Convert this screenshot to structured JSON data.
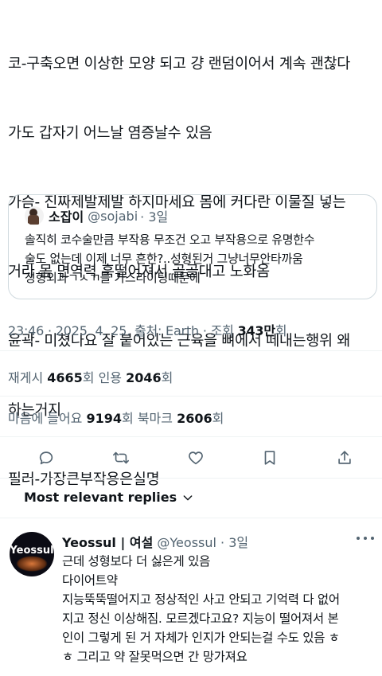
{
  "tweet": {
    "lines": [
      "코-구축오면 이상한 모양 되고 걍 랜덤이어서 계속 괜찮다",
      "가도 갑자기 어느날 염증날수 있음",
      "가슴- 진짜제발제발 하지마세요 몸에 커다란 이물질 넣는",
      "거라 몸 면역력 훅떨어져서 골골대고 노화옴",
      "윤곽- 미쳤나요 잘 붙어있는 근육을 뼈에서 떼내는행위 왜",
      "하는거지",
      "필러-가장큰부작용은실명"
    ]
  },
  "quote": {
    "name": "소잡이",
    "handle": "@sojabi",
    "time": "· 3일",
    "lines": [
      "솔직히 코수술만큼 부작용 무조건 오고 부작용으로 유명한수",
      "술도 없는데  이제 너무 흔한?..성형된거 그냥너무안타까움",
      "성형외과ㄱㅅㄲ들 가스라이팅때문에"
    ]
  },
  "meta": {
    "time": "23:46 · 2025. 4. 25. 출처: Earth · 조회 ",
    "views": "343만",
    "views_suffix": "회"
  },
  "stats": {
    "retweets_label": "재게시 ",
    "retweets": "4665",
    "retweets_unit": "회  인용 ",
    "quotes": "2046",
    "quotes_unit": "회",
    "likes_label": "마음에 들어요 ",
    "likes": "9194",
    "likes_unit": "회  북마크 ",
    "bookmarks": "2606",
    "bookmarks_unit": "회"
  },
  "icons": {
    "reply": "reply-icon",
    "retweet": "retweet-icon",
    "like": "heart-icon",
    "bookmark": "bookmark-icon",
    "share": "share-icon"
  },
  "sort_label": "Most relevant replies",
  "reply": {
    "avatar_text": "Yeossul",
    "name": "Yeossul | 여설",
    "handle": "@Yeossul",
    "time": "· 3일",
    "lines": [
      "근데 성형보다 더 싫은게 있음",
      "다이어트약",
      "지능뚝뚝떨어지고 정상적인 사고 안되고 기억력 다 없어",
      "지고 정신 이상해짐. 모르겠다고요? 지능이 떨어져서 본",
      "인이 그렇게 된 거 자체가 인지가 안되는걸 수도 있음 ㅎ",
      "ㅎ 그리고 약 잘못먹으면 간 망가져요"
    ]
  }
}
